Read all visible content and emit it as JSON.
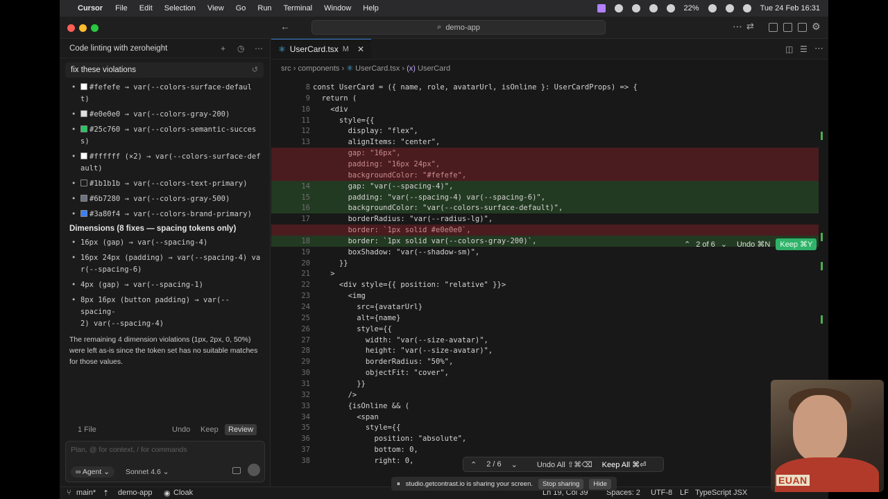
{
  "menubar": {
    "app_name": "Cursor",
    "items": [
      "File",
      "Edit",
      "Selection",
      "View",
      "Go",
      "Run",
      "Terminal",
      "Window",
      "Help"
    ],
    "battery": "22%",
    "datetime": "Tue 24 Feb  16:31"
  },
  "titlebar": {
    "search": "demo-app"
  },
  "chat": {
    "title": "Code linting with zeroheight",
    "user_message": "fix these violations",
    "color_items": [
      {
        "swatch": "#fefefe",
        "text": "#fefefe → var(--colors-surface-defaul",
        "cont": "t)"
      },
      {
        "swatch": "#e0e0e0",
        "text": "#e0e0e0 → var(--colors-gray-200)",
        "cont": ""
      },
      {
        "swatch": "#25c760",
        "text": "#25c760 → var(--colors-semantic-succes",
        "cont": "s)"
      },
      {
        "swatch": "#ffffff",
        "text": "#ffffff (×2) → var(--colors-surface-def",
        "cont": "ault)"
      },
      {
        "swatch": "#1b1b1b",
        "text": "#1b1b1b → var(--colors-text-primary)",
        "cont": ""
      },
      {
        "swatch": "#6b7280",
        "text": "#6b7280 → var(--colors-gray-500)",
        "cont": ""
      },
      {
        "swatch": "#3a80f4",
        "text": "#3a80f4 → var(--colors-brand-primary)",
        "cont": ""
      }
    ],
    "dimensions_heading": "Dimensions (8 fixes — spacing tokens only)",
    "dimension_items": [
      {
        "text": "16px (gap) → var(--spacing-4)",
        "cont": ""
      },
      {
        "text": "16px 24px (padding) → var(--spacing-4) va",
        "cont": "r(--spacing-6)"
      },
      {
        "text": "4px (gap) → var(--spacing-1)",
        "cont": ""
      },
      {
        "text": "8px 16px (button padding) → var(--spacing-",
        "cont": "2) var(--spacing-4)"
      }
    ],
    "remaining_note": "The remaining 4 dimension violations (1px, 2px, 0, 50%) were left as-is since the token set has no suitable matches for those values.",
    "files_label": "1 File",
    "undo": "Undo",
    "keep": "Keep",
    "review": "Review",
    "composer_placeholder": "Plan, @ for context, / for commands",
    "agent": "Agent",
    "model": "Sonnet 4.6"
  },
  "editor": {
    "tab": {
      "name": "UserCard.tsx",
      "status": "M"
    },
    "breadcrumb": [
      "src",
      "components",
      "UserCard.tsx",
      "UserCard"
    ],
    "hunk": {
      "position": "2 of 6",
      "undo": "Undo ⌘N",
      "keep": "Keep ⌘Y"
    },
    "review_nav": {
      "position": "2 / 6",
      "undo_all": "Undo All ⇧⌘⌫",
      "keep_all": "Keep All ⌘⏎"
    },
    "lines": [
      {
        "n": "8",
        "type": "normal",
        "code": "const UserCard = ({ name, role, avatarUrl, isOnline }: UserCardProps) => {"
      },
      {
        "n": "9",
        "type": "normal",
        "code": "  return ("
      },
      {
        "n": "10",
        "type": "normal",
        "code": "    <div"
      },
      {
        "n": "11",
        "type": "normal",
        "code": "      style={{"
      },
      {
        "n": "12",
        "type": "normal",
        "code": "        display: \"flex\","
      },
      {
        "n": "13",
        "type": "normal",
        "code": "        alignItems: \"center\","
      },
      {
        "n": "",
        "type": "del",
        "code": "        gap: \"16px\","
      },
      {
        "n": "",
        "type": "del",
        "code": "        padding: \"16px 24px\","
      },
      {
        "n": "",
        "type": "del",
        "code": "        backgroundColor: \"#fefefe\","
      },
      {
        "n": "14",
        "type": "add",
        "code": "        gap: \"var(--spacing-4)\","
      },
      {
        "n": "15",
        "type": "add",
        "code": "        padding: \"var(--spacing-4) var(--spacing-6)\","
      },
      {
        "n": "16",
        "type": "add",
        "code": "        backgroundColor: \"var(--colors-surface-default)\","
      },
      {
        "n": "17",
        "type": "normal",
        "code": "        borderRadius: \"var(--radius-lg)\","
      },
      {
        "n": "",
        "type": "del",
        "code": "        border: `1px solid #e0e0e0`,"
      },
      {
        "n": "18",
        "type": "add",
        "code": "        border: `1px solid var(--colors-gray-200)`,"
      },
      {
        "n": "19",
        "type": "normal",
        "code": "        boxShadow: \"var(--shadow-sm)\","
      },
      {
        "n": "20",
        "type": "normal",
        "code": "      }}"
      },
      {
        "n": "21",
        "type": "normal",
        "code": "    >"
      },
      {
        "n": "22",
        "type": "normal",
        "code": "      <div style={{ position: \"relative\" }}>"
      },
      {
        "n": "23",
        "type": "normal",
        "code": "        <img"
      },
      {
        "n": "24",
        "type": "normal",
        "code": "          src={avatarUrl}"
      },
      {
        "n": "25",
        "type": "normal",
        "code": "          alt={name}"
      },
      {
        "n": "26",
        "type": "normal",
        "code": "          style={{"
      },
      {
        "n": "27",
        "type": "normal",
        "code": "            width: \"var(--size-avatar)\","
      },
      {
        "n": "28",
        "type": "normal",
        "code": "            height: \"var(--size-avatar)\","
      },
      {
        "n": "29",
        "type": "normal",
        "code": "            borderRadius: \"50%\","
      },
      {
        "n": "30",
        "type": "normal",
        "code": "            objectFit: \"cover\","
      },
      {
        "n": "31",
        "type": "normal",
        "code": "          }}"
      },
      {
        "n": "32",
        "type": "normal",
        "code": "        />"
      },
      {
        "n": "33",
        "type": "normal",
        "code": "        {isOnline && ("
      },
      {
        "n": "34",
        "type": "normal",
        "code": "          <span"
      },
      {
        "n": "35",
        "type": "normal",
        "code": "            style={{"
      },
      {
        "n": "36",
        "type": "normal",
        "code": "              position: \"absolute\","
      },
      {
        "n": "37",
        "type": "normal",
        "code": "              bottom: 0,"
      },
      {
        "n": "38",
        "type": "normal",
        "code": "              right: 0,"
      }
    ]
  },
  "share_banner": {
    "text": "studio.getcontrast.io is sharing your screen.",
    "stop": "Stop sharing",
    "hide": "Hide"
  },
  "statusbar": {
    "branch": "main*",
    "project": "demo-app",
    "cloak": "Cloak",
    "position": "Ln 19, Col 39",
    "spaces": "Spaces: 2",
    "encoding": "UTF-8",
    "eol": "LF",
    "language": "TypeScript JSX"
  },
  "webcam": {
    "logo": "EUAN"
  },
  "colors": {
    "deleted_bg": "#4a1c1f",
    "added_bg": "#233a22",
    "keep_button": "#2fb36a"
  }
}
